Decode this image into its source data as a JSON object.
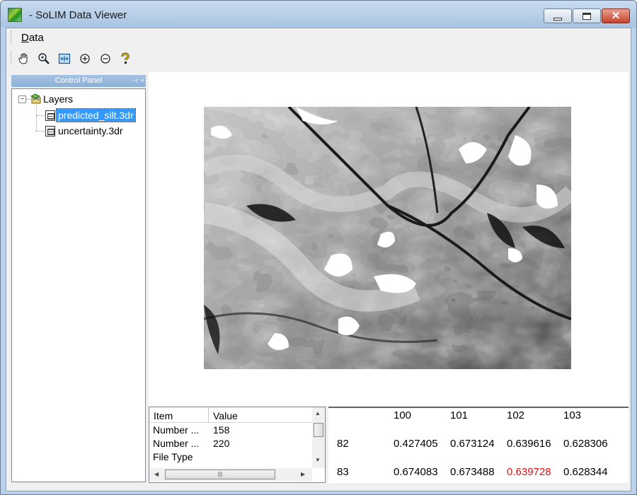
{
  "window": {
    "title": "- SoLIM Data Viewer"
  },
  "menu": {
    "data_label": "Data"
  },
  "toolbar": {
    "tools": [
      "pan-icon",
      "zoom-icon",
      "full-extent-icon",
      "zoom-in-icon",
      "zoom-out-icon",
      "help-icon"
    ]
  },
  "control_panel": {
    "title": "Control Panel",
    "tree": {
      "root_label": "Layers",
      "expander": "−",
      "files": [
        "predicted_silt.3dr",
        "uncertainty.3dr"
      ],
      "selected_index": 0
    }
  },
  "properties": {
    "columns": [
      "Item",
      "Value"
    ],
    "rows": [
      {
        "item": "Number ...",
        "value": "158"
      },
      {
        "item": "Number ...",
        "value": "220"
      },
      {
        "item": "File Type",
        "value": ""
      }
    ]
  },
  "data_grid": {
    "col_headers": [
      "100",
      "101",
      "102",
      "103"
    ],
    "rows": [
      {
        "row_label": "82",
        "values": [
          "0.427405",
          "0.673124",
          "0.639616",
          "0.628306"
        ]
      },
      {
        "row_label": "83",
        "values": [
          "0.674083",
          "0.673488",
          "0.639728",
          "0.628344"
        ]
      }
    ],
    "highlight_color": "#e81010"
  },
  "colors": {
    "selection": "#3399ff",
    "titlebar": "#b9d1ea"
  }
}
